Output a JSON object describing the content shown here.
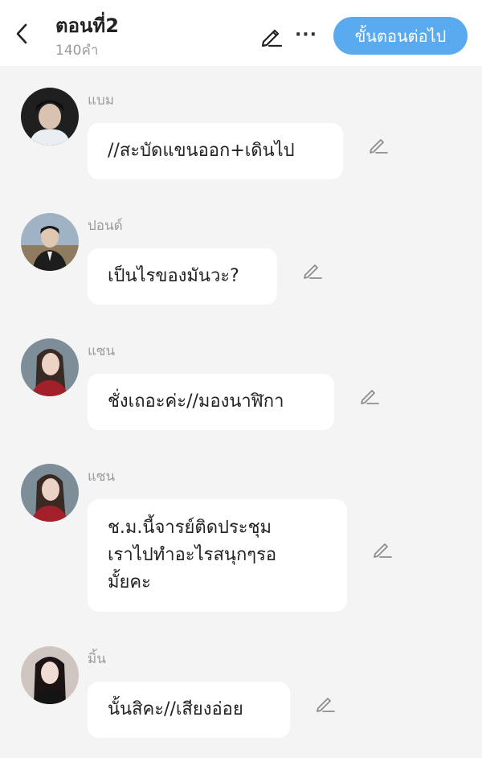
{
  "header": {
    "title": "ตอนที่2",
    "word_count": "140คำ",
    "next_label": "ขั้นตอนต่อไป",
    "more_label": "···",
    "accent_color": "#5aaaf0"
  },
  "messages": [
    {
      "name": "แบม",
      "text": "//สะบัดแขนออก+เดินไป",
      "avatar": "avatar-boy-1"
    },
    {
      "name": "ปอนด์",
      "text": "เป็นไรของมันวะ?",
      "avatar": "avatar-boy-2"
    },
    {
      "name": "แซน",
      "text": "ชั่งเถอะค่ะ//มองนาฬิกา",
      "avatar": "avatar-girl-red"
    },
    {
      "name": "แซน",
      "text": "ช.ม.นี้จารย์ติดประชุม\nเราไปทำอะไรสนุกๆรอ\nมั้ยคะ",
      "avatar": "avatar-girl-red"
    },
    {
      "name": "มิ้น",
      "text": "นั้นสิคะ//เสียงอ่อย",
      "avatar": "avatar-girl-dark"
    }
  ]
}
